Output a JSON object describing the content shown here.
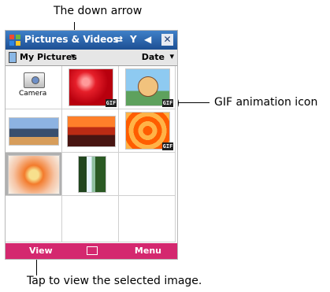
{
  "annotations": {
    "down_arrow": "The down arrow",
    "gif_icon": "GIF animation icon",
    "tap_view": "Tap to view the selected image."
  },
  "window": {
    "title": "Pictures & Videos",
    "close_symbol": "✕",
    "sync_symbol": "⇄",
    "signal_symbol": "Y",
    "volume_symbol": "◀"
  },
  "folder_bar": {
    "folder": "My Pictures",
    "sort": "Date",
    "dropdown_symbol": "▾"
  },
  "grid": {
    "camera_label": "Camera",
    "gif_badge": "GIF"
  },
  "menu_bar": {
    "left": "View",
    "right": "Menu"
  }
}
